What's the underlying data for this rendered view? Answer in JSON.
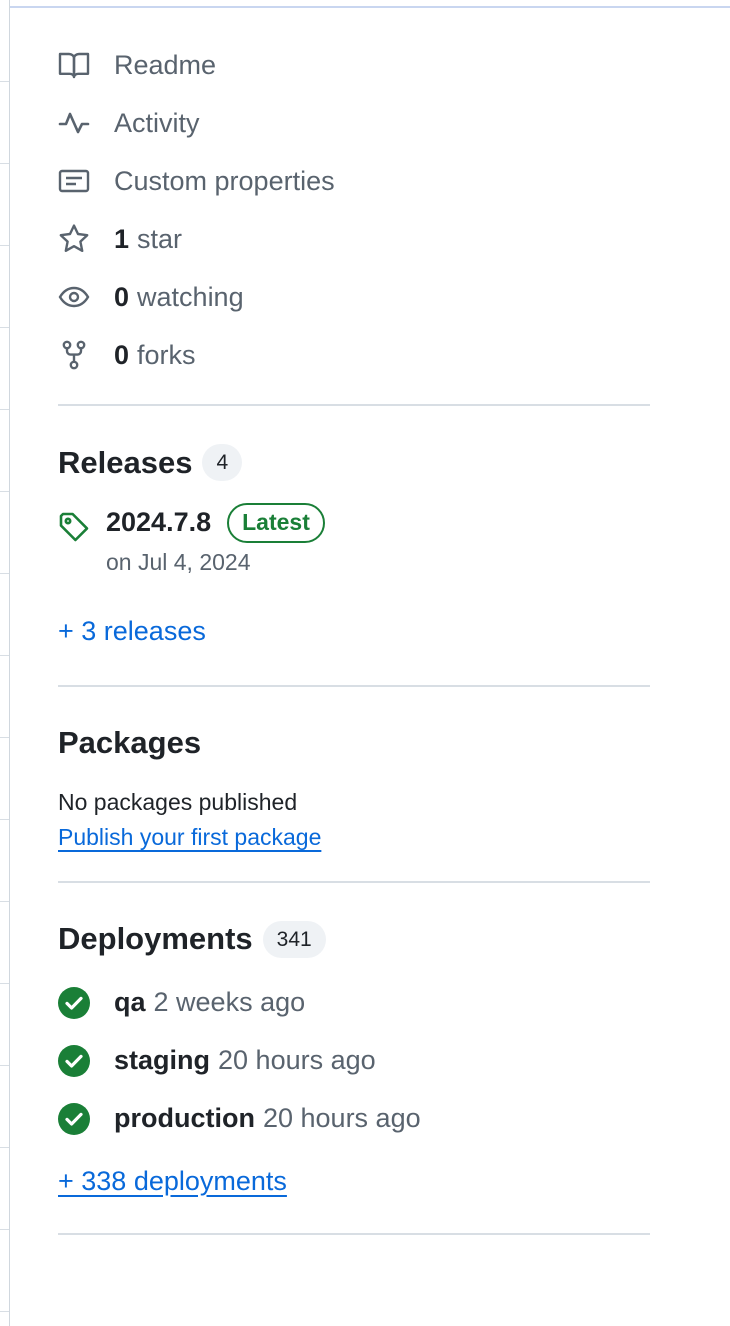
{
  "about_stats": [
    {
      "icon": "book-icon",
      "bold": "",
      "label": "Readme"
    },
    {
      "icon": "pulse-icon",
      "bold": "",
      "label": "Activity"
    },
    {
      "icon": "note-icon",
      "bold": "",
      "label": "Custom properties"
    },
    {
      "icon": "star-icon",
      "bold": "1",
      "label": "star"
    },
    {
      "icon": "eye-icon",
      "bold": "0",
      "label": "watching"
    },
    {
      "icon": "repo-forked-icon",
      "bold": "0",
      "label": "forks"
    }
  ],
  "releases": {
    "title": "Releases",
    "count": "4",
    "latest": {
      "name": "2024.7.8",
      "badge": "Latest",
      "date": "on Jul 4, 2024"
    },
    "more_link": "+ 3 releases"
  },
  "packages": {
    "title": "Packages",
    "empty_text": "No packages published",
    "publish_link": "Publish your first package"
  },
  "deployments": {
    "title": "Deployments",
    "count": "341",
    "items": [
      {
        "env": "qa",
        "time": "2 weeks ago"
      },
      {
        "env": "staging",
        "time": "20 hours ago"
      },
      {
        "env": "production",
        "time": "20 hours ago"
      }
    ],
    "more_link": "+ 338 deployments"
  },
  "colors": {
    "link": "#0969da",
    "success": "#1a7f37",
    "muted": "#59636e",
    "text": "#1f2328"
  }
}
